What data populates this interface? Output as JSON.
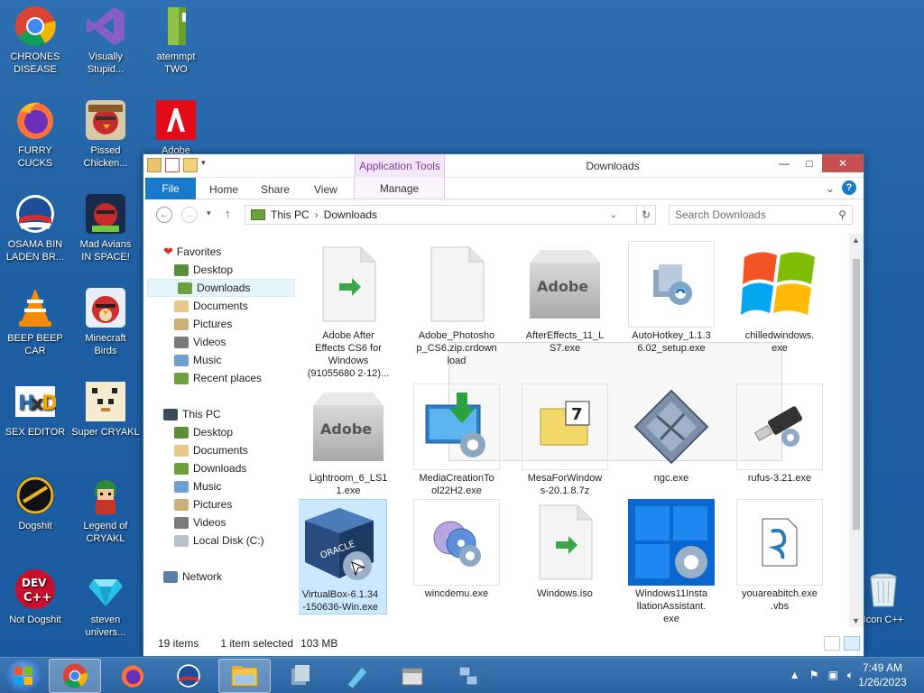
{
  "desktop": {
    "icons": [
      {
        "label": "CHRONES\nDISEASE",
        "icon": "chrome-icon"
      },
      {
        "label": "Visually\nStupid...",
        "icon": "visual-studio-icon"
      },
      {
        "label": "atemmpt\nTWO",
        "icon": "folder-green-icon"
      },
      {
        "label": "FURRY CUCKS",
        "icon": "firefox-icon"
      },
      {
        "label": "Pissed\nChicken...",
        "icon": "angry-birds-seasons-icon"
      },
      {
        "label": "Adobe",
        "icon": "adobe-icon"
      },
      {
        "label": "OSAMA BIN\nLADEN BR...",
        "icon": "obama-logo-icon"
      },
      {
        "label": "Mad Avians\nIN SPACE!",
        "icon": "angry-birds-space-icon"
      },
      {
        "label": "BEEP BEEP\nCAR",
        "icon": "vlc-icon"
      },
      {
        "label": "Minecraft\nBirds",
        "icon": "angry-birds-icon"
      },
      {
        "label": "SEX EDITOR",
        "icon": "hxd-icon"
      },
      {
        "label": "Super CRYAKL",
        "icon": "pixel-cat-icon"
      },
      {
        "label": "Dogshit",
        "icon": "dogshit-icon"
      },
      {
        "label": "Legend of\nCRYAKL",
        "icon": "legend-icon"
      },
      {
        "label": "Not Dogshit",
        "icon": "devcpp-icon"
      },
      {
        "label": "steven\nunivers...",
        "icon": "diamond-icon"
      },
      {
        "label": "Icon C++",
        "icon": "recycle-bin-icon"
      }
    ]
  },
  "window": {
    "app_tools": "Application Tools",
    "title": "Downloads",
    "ribbon_tabs": [
      "File",
      "Home",
      "Share",
      "View",
      "Manage"
    ],
    "help": "?",
    "address": {
      "root": "This PC",
      "sep": "›",
      "current": "Downloads"
    },
    "search_placeholder": "Search Downloads",
    "nav": {
      "favorites_header": "Favorites",
      "favorites": [
        "Desktop",
        "Downloads",
        "Recent places"
      ],
      "libraries": [
        "Documents",
        "Pictures",
        "Videos",
        "Music"
      ],
      "thispc_header": "This PC",
      "thispc": [
        "Desktop",
        "Documents",
        "Downloads",
        "Music",
        "Pictures",
        "Videos",
        "Local Disk (C:)"
      ],
      "network": "Network"
    },
    "files": [
      {
        "name": "Adobe After\nEffects CS6 for\nWindows\n(91055680 2-12)...",
        "icon": "iso-file-icon"
      },
      {
        "name": "Adobe_Photosho\np_CS6.zip.crdown\nload",
        "icon": "blank-file-icon"
      },
      {
        "name": "AfterEffects_11_L\nS7.exe",
        "icon": "adobe-box-icon"
      },
      {
        "name": "AutoHotkey_1.1.3\n6.02_setup.exe",
        "icon": "installer-icon"
      },
      {
        "name": "chilledwindows.\nexe",
        "icon": "windows-flag-icon"
      },
      {
        "name": "Lightroom_6_LS1\n1.exe",
        "icon": "adobe-box-icon"
      },
      {
        "name": "MediaCreationTo\nol22H2.exe",
        "icon": "media-creation-icon"
      },
      {
        "name": "MesaForWindow\ns-20.1.8.7z",
        "icon": "7z-archive-icon"
      },
      {
        "name": "ngc.exe",
        "icon": "ngc-icon"
      },
      {
        "name": "rufus-3.21.exe",
        "icon": "usb-drive-icon"
      },
      {
        "name": "VirtualBox-6.1.34\n-150636-Win.exe",
        "icon": "virtualbox-icon"
      },
      {
        "name": "wincdemu.exe",
        "icon": "disc-icon"
      },
      {
        "name": "Windows.iso",
        "icon": "iso-file-icon"
      },
      {
        "name": "Windows11Insta\nllationAssistant.\nexe",
        "icon": "windows11-icon"
      },
      {
        "name": "youareabitch.exe\n.vbs",
        "icon": "script-icon"
      }
    ],
    "status": {
      "count": "19 items",
      "selected": "1 item selected",
      "size": "103 MB"
    }
  },
  "taskbar": {
    "time": "7:49 AM",
    "date": "1/26/2023"
  },
  "colors": {
    "accent": "#1979ca",
    "desktop": "#1f5fa3",
    "selection": "#cce8ff"
  }
}
